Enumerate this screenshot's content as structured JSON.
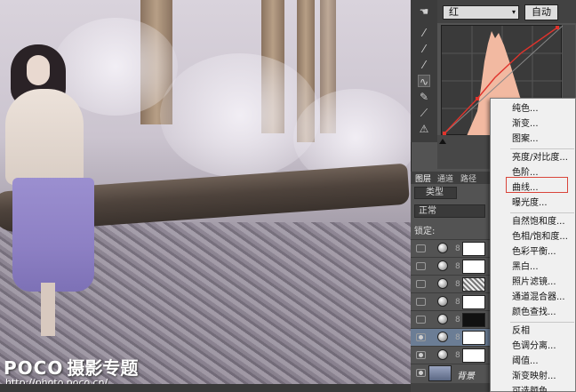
{
  "watermark": {
    "logo": "POCO",
    "subtitle": "摄影专题",
    "url": "http://photo.poco.cn/"
  },
  "curves": {
    "channel": "红",
    "auto_label": "自动",
    "curve_color": "#e0332c",
    "histogram_color": "#f2b9a1"
  },
  "layers": {
    "tabs": [
      "图层",
      "通道",
      "路径"
    ],
    "kind_filter": "类型",
    "blend_mode": "正常",
    "lock_label": "锁定:",
    "background_layer_name": "背景"
  },
  "adjustment_menu": {
    "groups": [
      [
        "纯色...",
        "渐变...",
        "图案..."
      ],
      [
        "亮度/对比度...",
        "色阶...",
        "曲线...",
        "曝光度..."
      ],
      [
        "自然饱和度...",
        "色相/饱和度...",
        "色彩平衡...",
        "黑白...",
        "照片滤镜...",
        "通道混合器...",
        "颜色查找..."
      ],
      [
        "反相",
        "色调分离...",
        "阈值...",
        "渐变映射...",
        "可选颜色..."
      ]
    ],
    "highlighted_item": "曲线...",
    "highlight_color": "#d9453a"
  }
}
